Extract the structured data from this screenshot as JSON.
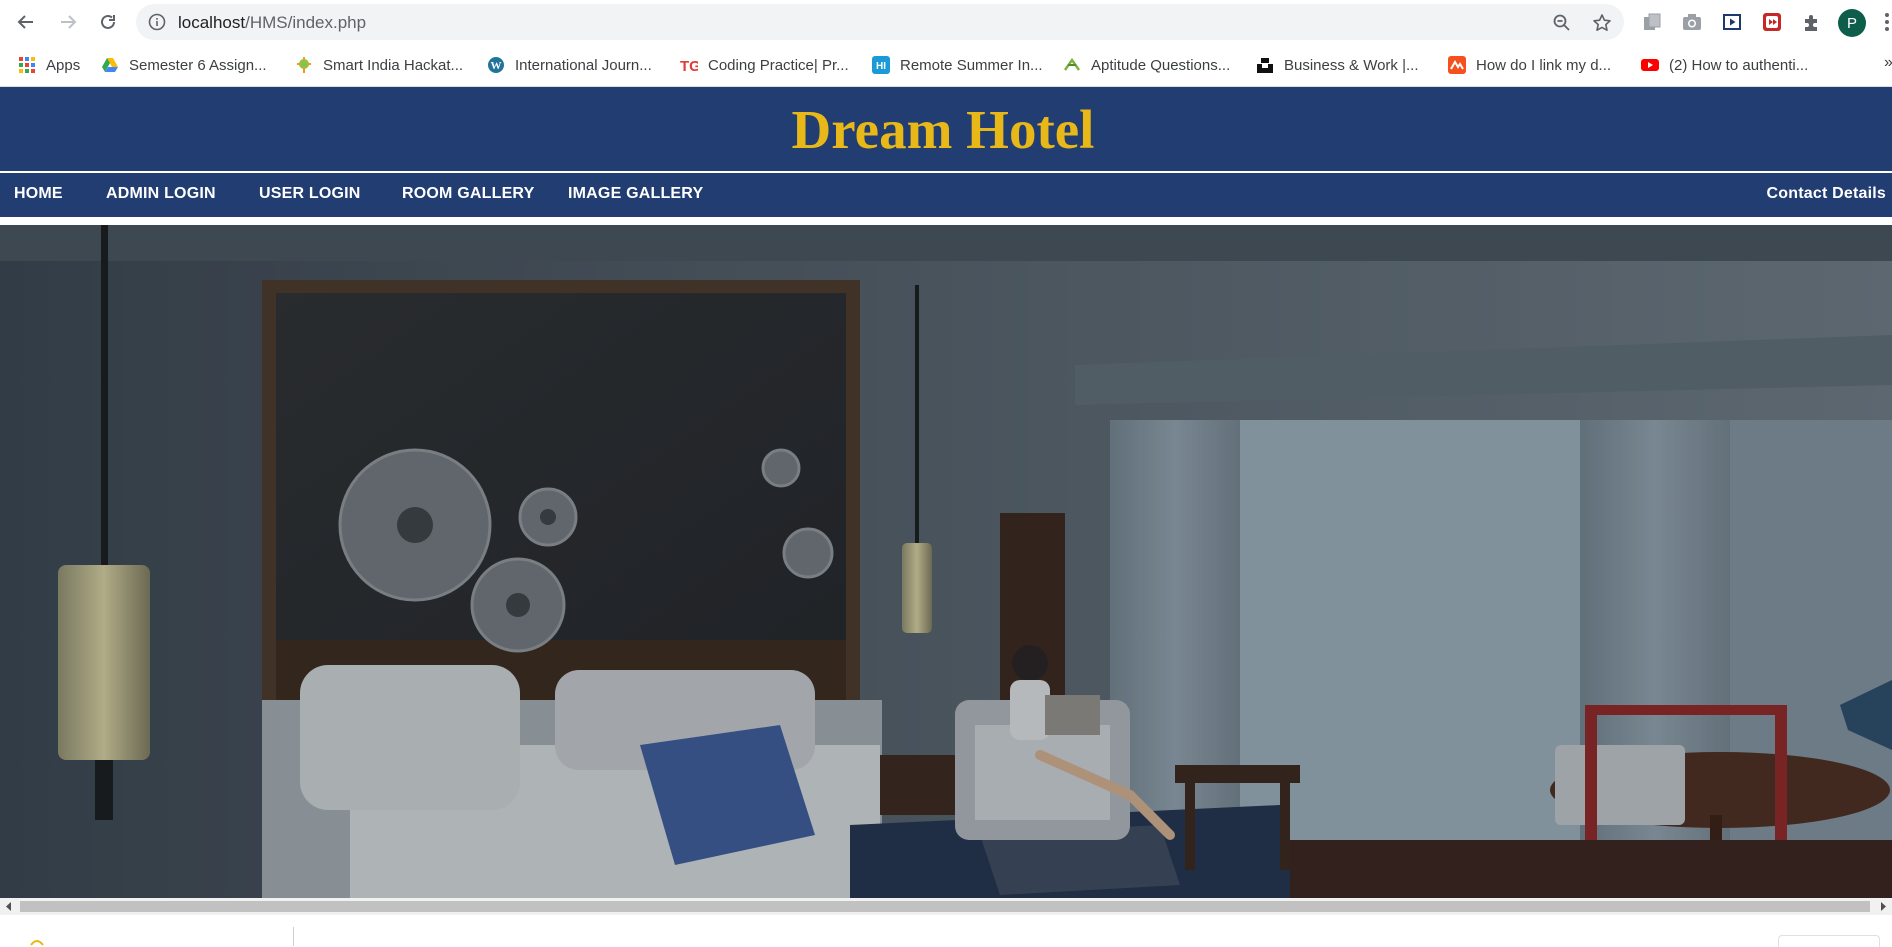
{
  "browser": {
    "url_host": "localhost",
    "url_path": "/HMS/index.php",
    "avatar_letter": "P",
    "bookmarks": [
      {
        "label": "Apps",
        "icon": "apps-grid-icon"
      },
      {
        "label": "Semester 6 Assign...",
        "icon": "google-drive-icon"
      },
      {
        "label": "Smart India Hackat...",
        "icon": "sih-icon"
      },
      {
        "label": "International Journ...",
        "icon": "wordpress-icon"
      },
      {
        "label": "Coding Practice| Pr...",
        "icon": "tg-icon"
      },
      {
        "label": "Remote Summer In...",
        "icon": "hi-icon"
      },
      {
        "label": "Aptitude Questions...",
        "icon": "aptitude-icon"
      },
      {
        "label": "Business & Work |...",
        "icon": "unsplash-icon"
      },
      {
        "label": "How do I link my d...",
        "icon": "bookmark-orange-icon"
      },
      {
        "label": "(2) How to authenti...",
        "icon": "youtube-icon"
      }
    ],
    "more_bookmarks": "»"
  },
  "site": {
    "title": "Dream Hotel",
    "nav": [
      {
        "label": "HOME"
      },
      {
        "label": "ADMIN LOGIN"
      },
      {
        "label": "USER LOGIN"
      },
      {
        "label": "ROOM GALLERY"
      },
      {
        "label": "IMAGE GALLERY"
      }
    ],
    "contact": "Contact Details"
  },
  "colors": {
    "header_bg": "#213d72",
    "title_color": "#e8b818",
    "nav_text": "#ffffff"
  }
}
